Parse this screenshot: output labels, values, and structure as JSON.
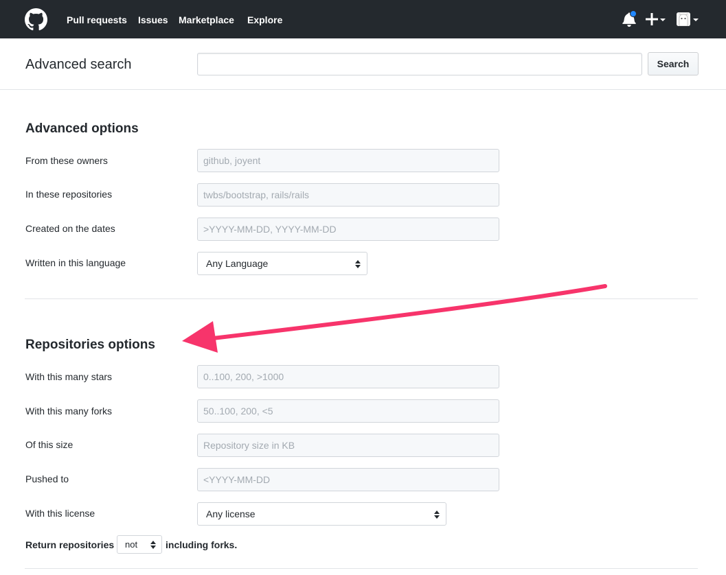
{
  "header": {
    "logo": "github-octocat-icon",
    "nav": [
      "Pull requests",
      "Issues",
      "Marketplace",
      "Explore"
    ],
    "icons": [
      "bell-icon",
      "plus-icon",
      "avatar"
    ]
  },
  "search": {
    "title": "Advanced search",
    "value": "",
    "button": "Search"
  },
  "advanced_options": {
    "title": "Advanced options",
    "fields": [
      {
        "label": "From these owners",
        "placeholder": "github, joyent"
      },
      {
        "label": "In these repositories",
        "placeholder": "twbs/bootstrap, rails/rails"
      },
      {
        "label": "Created on the dates",
        "placeholder": ">YYYY-MM-DD, YYYY-MM-DD"
      },
      {
        "label": "Written in this language",
        "selected": "Any Language"
      }
    ]
  },
  "repositories_options": {
    "title": "Repositories options",
    "fields": [
      {
        "label": "With this many stars",
        "placeholder": "0..100, 200, >1000"
      },
      {
        "label": "With this many forks",
        "placeholder": "50..100, 200, <5"
      },
      {
        "label": "Of this size",
        "placeholder": "Repository size in KB"
      },
      {
        "label": "Pushed to",
        "placeholder": "<YYYY-MM-DD"
      },
      {
        "label": "With this license",
        "selected": "Any license"
      }
    ],
    "return_prefix": "Return repositories",
    "return_select": "not",
    "return_suffix": "including forks."
  },
  "colors": {
    "header_bg": "#24292e",
    "notification_dot": "#2188ff",
    "annotation_arrow": "#f7346b"
  }
}
